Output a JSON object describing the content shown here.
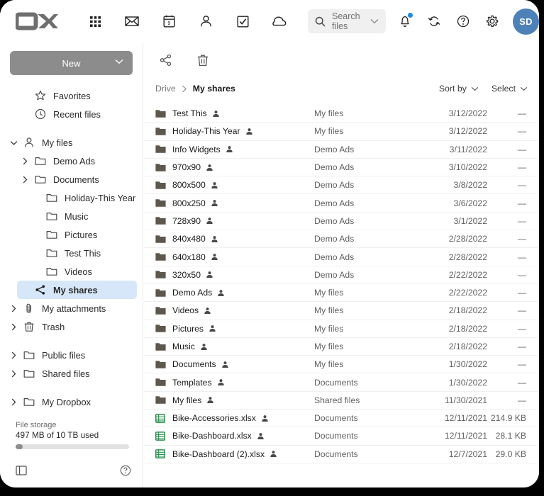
{
  "window": {
    "title": "OX Drive"
  },
  "topbar": {
    "logo_alt": "ox-logo",
    "app_icons": [
      {
        "name": "app-grid-icon",
        "label": "Apps"
      },
      {
        "name": "mail-icon",
        "label": "Mail"
      },
      {
        "name": "calendar-icon",
        "label": "Calendar"
      },
      {
        "name": "contacts-icon",
        "label": "Address Book"
      },
      {
        "name": "tasks-icon",
        "label": "Tasks"
      },
      {
        "name": "drive-icon",
        "label": "Drive"
      }
    ],
    "search": {
      "placeholder": "Search files",
      "value": ""
    },
    "right_icons": [
      {
        "name": "notifications-bell-icon",
        "label": "Notifications",
        "badge": true
      },
      {
        "name": "refresh-icon",
        "label": "Refresh"
      },
      {
        "name": "help-icon",
        "label": "Help"
      },
      {
        "name": "settings-gear-icon",
        "label": "Settings"
      }
    ],
    "avatar": {
      "initials": "SD",
      "color": "#4d81b8"
    }
  },
  "sidebar": {
    "new_button": "New",
    "items": [
      {
        "label": "Favorites",
        "icon": "star-icon",
        "caret": "none",
        "indent": 1,
        "selected": false
      },
      {
        "label": "Recent files",
        "icon": "clock-icon",
        "caret": "none",
        "indent": 1,
        "selected": false
      },
      {
        "label": "My files",
        "icon": "person-icon",
        "caret": "expanded",
        "indent": 0,
        "selected": false
      },
      {
        "label": "Demo Ads",
        "icon": "folder-icon",
        "caret": "collapsed",
        "indent": 1,
        "selected": false
      },
      {
        "label": "Documents",
        "icon": "folder-icon",
        "caret": "collapsed",
        "indent": 1,
        "selected": false
      },
      {
        "label": "Holiday-This Year",
        "icon": "folder-icon",
        "caret": "none",
        "indent": 2,
        "selected": false
      },
      {
        "label": "Music",
        "icon": "folder-icon",
        "caret": "none",
        "indent": 2,
        "selected": false
      },
      {
        "label": "Pictures",
        "icon": "folder-icon",
        "caret": "none",
        "indent": 2,
        "selected": false
      },
      {
        "label": "Test This",
        "icon": "folder-icon",
        "caret": "none",
        "indent": 2,
        "selected": false
      },
      {
        "label": "Videos",
        "icon": "folder-icon",
        "caret": "none",
        "indent": 2,
        "selected": false
      },
      {
        "label": "My shares",
        "icon": "share-icon",
        "caret": "none",
        "indent": 1,
        "selected": true
      },
      {
        "label": "My attachments",
        "icon": "paperclip-icon",
        "caret": "collapsed",
        "indent": 0,
        "selected": false
      },
      {
        "label": "Trash",
        "icon": "trash-icon",
        "caret": "collapsed",
        "indent": 0,
        "selected": false
      },
      {
        "label": "Public files",
        "icon": "folder-icon",
        "caret": "collapsed",
        "indent": 0,
        "selected": false
      },
      {
        "label": "Shared files",
        "icon": "folder-icon",
        "caret": "collapsed",
        "indent": 0,
        "selected": false
      },
      {
        "label": "My Dropbox",
        "icon": "folder-icon",
        "caret": "collapsed",
        "indent": 0,
        "selected": false
      }
    ],
    "storage": {
      "label": "File storage",
      "value": "497 MB of 10 TB used",
      "percent": 4
    },
    "bottom": {
      "toggle_sidebar": "toggle-sidebar-icon",
      "help": "help-circle-icon"
    }
  },
  "main": {
    "toolbar": [
      {
        "name": "share-button",
        "label": "Share"
      },
      {
        "name": "delete-button",
        "label": "Delete"
      }
    ],
    "breadcrumb": {
      "root": "Drive",
      "current": "My shares"
    },
    "controls": {
      "sort_by": "Sort by",
      "select": "Select"
    },
    "files": [
      {
        "name": "Test This",
        "type": "folder",
        "shared": true,
        "location": "My files",
        "date": "3/12/2022",
        "size": "—"
      },
      {
        "name": "Holiday-This Year",
        "type": "folder",
        "shared": true,
        "location": "My files",
        "date": "3/12/2022",
        "size": "—"
      },
      {
        "name": "Info Widgets",
        "type": "folder",
        "shared": true,
        "location": "Demo Ads",
        "date": "3/11/2022",
        "size": "—"
      },
      {
        "name": "970x90",
        "type": "folder",
        "shared": true,
        "location": "Demo Ads",
        "date": "3/10/2022",
        "size": "—"
      },
      {
        "name": "800x500",
        "type": "folder",
        "shared": true,
        "location": "Demo Ads",
        "date": "3/8/2022",
        "size": "—"
      },
      {
        "name": "800x250",
        "type": "folder",
        "shared": true,
        "location": "Demo Ads",
        "date": "3/6/2022",
        "size": "—"
      },
      {
        "name": "728x90",
        "type": "folder",
        "shared": true,
        "location": "Demo Ads",
        "date": "3/1/2022",
        "size": "—"
      },
      {
        "name": "840x480",
        "type": "folder",
        "shared": true,
        "location": "Demo Ads",
        "date": "2/28/2022",
        "size": "—"
      },
      {
        "name": "640x180",
        "type": "folder",
        "shared": true,
        "location": "Demo Ads",
        "date": "2/28/2022",
        "size": "—"
      },
      {
        "name": "320x50",
        "type": "folder",
        "shared": true,
        "location": "Demo Ads",
        "date": "2/22/2022",
        "size": "—"
      },
      {
        "name": "Demo Ads",
        "type": "folder",
        "shared": true,
        "location": "My files",
        "date": "2/22/2022",
        "size": "—"
      },
      {
        "name": "Videos",
        "type": "folder",
        "shared": true,
        "location": "My files",
        "date": "2/18/2022",
        "size": "—"
      },
      {
        "name": "Pictures",
        "type": "folder",
        "shared": true,
        "location": "My files",
        "date": "2/18/2022",
        "size": "—"
      },
      {
        "name": "Music",
        "type": "folder",
        "shared": true,
        "location": "My files",
        "date": "2/18/2022",
        "size": "—"
      },
      {
        "name": "Documents",
        "type": "folder",
        "shared": true,
        "location": "My files",
        "date": "1/30/2022",
        "size": "—"
      },
      {
        "name": "Templates",
        "type": "folder",
        "shared": true,
        "location": "Documents",
        "date": "1/30/2022",
        "size": "—"
      },
      {
        "name": "My files",
        "type": "folder",
        "shared": true,
        "location": "Shared files",
        "date": "11/30/2021",
        "size": "—"
      },
      {
        "name": "Bike-Accessories.xlsx",
        "type": "spreadsheet",
        "shared": true,
        "location": "Documents",
        "date": "12/11/2021",
        "size": "214.9 KB"
      },
      {
        "name": "Bike-Dashboard.xlsx",
        "type": "spreadsheet",
        "shared": true,
        "location": "Documents",
        "date": "12/11/2021",
        "size": "28.1 KB"
      },
      {
        "name": "Bike-Dashboard (2).xlsx",
        "type": "spreadsheet",
        "shared": true,
        "location": "Documents",
        "date": "12/7/2021",
        "size": "29.0 KB"
      }
    ]
  },
  "colors": {
    "accent_blue": "#4d81b8",
    "selected_bg": "#d6e7f9",
    "folder": "#5e574b",
    "spreadsheet": "#2f8f50",
    "new_button": "#8c8c8c"
  }
}
